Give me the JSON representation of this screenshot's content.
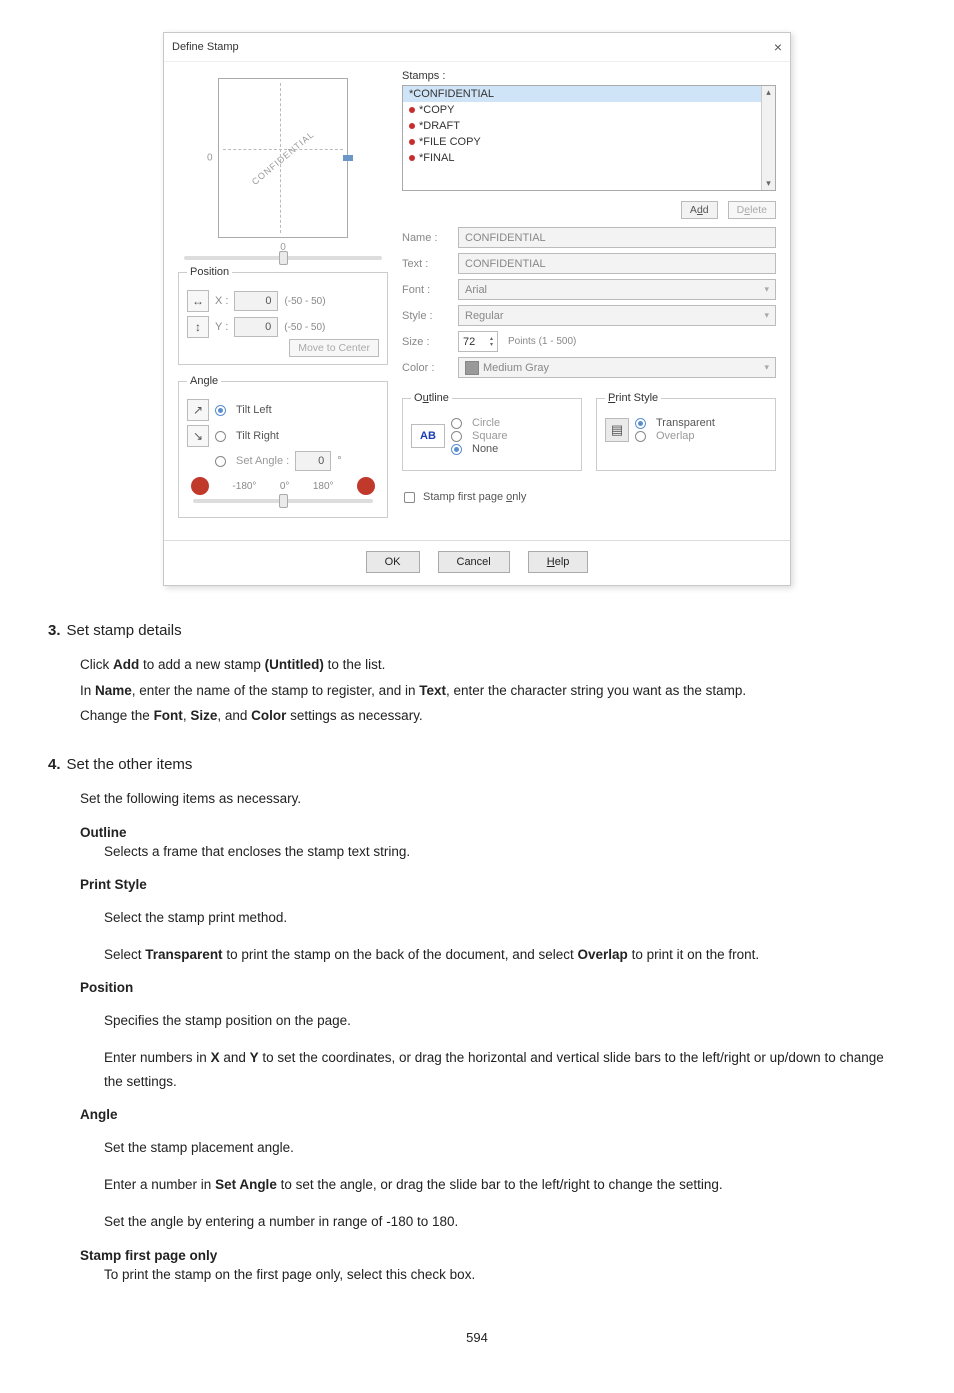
{
  "dialog": {
    "title": "Define Stamp",
    "close": "×",
    "stamps_label": "Stamps :",
    "stamps": [
      "*CONFIDENTIAL",
      "*COPY",
      "*DRAFT",
      "*FILE COPY",
      "*FINAL"
    ],
    "add_btn": "Add",
    "delete_btn": "Delete",
    "fields": {
      "name_lbl": "Name :",
      "name_val": "CONFIDENTIAL",
      "text_lbl": "Text :",
      "text_val": "CONFIDENTIAL",
      "font_lbl": "Font :",
      "font_val": "Arial",
      "style_lbl": "Style :",
      "style_val": "Regular",
      "size_lbl": "Size :",
      "size_val": "72",
      "size_hint": "Points (1 - 500)",
      "color_lbl": "Color :",
      "color_val": "Medium Gray"
    },
    "preview_text": "CONFIDENTIAL",
    "preview_zero": "0",
    "position": {
      "title": "Position",
      "x_lbl": "X :",
      "x_val": "0",
      "x_range": "(-50 - 50)",
      "y_lbl": "Y :",
      "y_val": "0",
      "y_range": "(-50 - 50)",
      "move_center": "Move to Center"
    },
    "angle": {
      "title": "Angle",
      "tilt_left": "Tilt Left",
      "tilt_right": "Tilt Right",
      "set_angle_lbl": "Set Angle :",
      "set_angle_val": "0",
      "deg": "°",
      "minus180": "-180°",
      "zero": "0°",
      "plus180": "180°"
    },
    "outline": {
      "title": "Outline",
      "ab": "AB",
      "circle": "Circle",
      "square": "Square",
      "none": "None"
    },
    "printstyle": {
      "title": "Print Style",
      "transparent": "Transparent",
      "overlap": "Overlap"
    },
    "first_page_only": "Stamp first page only",
    "footer": {
      "ok": "OK",
      "cancel": "Cancel",
      "help": "Help"
    }
  },
  "steps": {
    "s3": {
      "num": "3.",
      "title": "Set stamp details",
      "p1a": "Click ",
      "p1b": "Add",
      "p1c": " to add a new stamp ",
      "p1d": "(Untitled)",
      "p1e": " to the list.",
      "p2a": "In ",
      "p2b": "Name",
      "p2c": ", enter the name of the stamp to register, and in ",
      "p2d": "Text",
      "p2e": ", enter the character string you want as the stamp.",
      "p3a": "Change the ",
      "p3b": "Font",
      "p3c": ", ",
      "p3d": "Size",
      "p3e": ", and ",
      "p3f": "Color",
      "p3g": " settings as necessary."
    },
    "s4": {
      "num": "4.",
      "title": "Set the other items",
      "intro": "Set the following items as necessary.",
      "outline_t": "Outline",
      "outline_d": "Selects a frame that encloses the stamp text string.",
      "ps_t": "Print Style",
      "ps_d1": "Select the stamp print method.",
      "ps_d2a": "Select ",
      "ps_d2b": "Transparent",
      "ps_d2c": " to print the stamp on the back of the document, and select ",
      "ps_d2d": "Overlap",
      "ps_d2e": " to print it on the front.",
      "pos_t": "Position",
      "pos_d1": "Specifies the stamp position on the page.",
      "pos_d2a": "Enter numbers in ",
      "pos_d2b": "X",
      "pos_d2c": " and ",
      "pos_d2d": "Y",
      "pos_d2e": " to set the coordinates, or drag the horizontal and vertical slide bars to the left/right or up/down to change the settings.",
      "ang_t": "Angle",
      "ang_d1": "Set the stamp placement angle.",
      "ang_d2a": "Enter a number in ",
      "ang_d2b": "Set Angle",
      "ang_d2c": " to set the angle, or drag the slide bar to the left/right to change the setting.",
      "ang_d3": "Set the angle by entering a number in range of -180 to 180.",
      "fp_t": "Stamp first page only",
      "fp_d": "To print the stamp on the first page only, select this check box."
    }
  },
  "page_number": "594"
}
